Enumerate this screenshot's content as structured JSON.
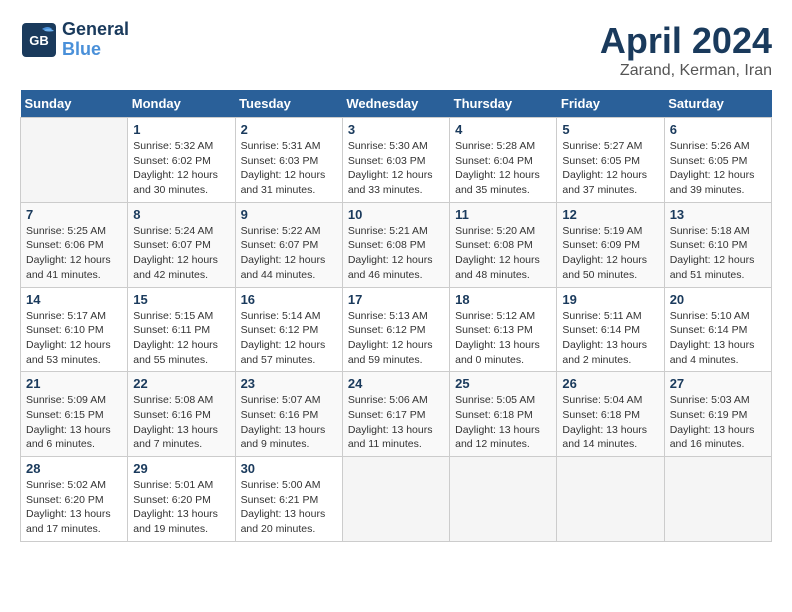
{
  "header": {
    "logo_line1": "General",
    "logo_line2": "Blue",
    "title": "April 2024",
    "subtitle": "Zarand, Kerman, Iran"
  },
  "calendar": {
    "days_of_week": [
      "Sunday",
      "Monday",
      "Tuesday",
      "Wednesday",
      "Thursday",
      "Friday",
      "Saturday"
    ],
    "weeks": [
      [
        {
          "num": "",
          "detail": ""
        },
        {
          "num": "1",
          "detail": "Sunrise: 5:32 AM\nSunset: 6:02 PM\nDaylight: 12 hours\nand 30 minutes."
        },
        {
          "num": "2",
          "detail": "Sunrise: 5:31 AM\nSunset: 6:03 PM\nDaylight: 12 hours\nand 31 minutes."
        },
        {
          "num": "3",
          "detail": "Sunrise: 5:30 AM\nSunset: 6:03 PM\nDaylight: 12 hours\nand 33 minutes."
        },
        {
          "num": "4",
          "detail": "Sunrise: 5:28 AM\nSunset: 6:04 PM\nDaylight: 12 hours\nand 35 minutes."
        },
        {
          "num": "5",
          "detail": "Sunrise: 5:27 AM\nSunset: 6:05 PM\nDaylight: 12 hours\nand 37 minutes."
        },
        {
          "num": "6",
          "detail": "Sunrise: 5:26 AM\nSunset: 6:05 PM\nDaylight: 12 hours\nand 39 minutes."
        }
      ],
      [
        {
          "num": "7",
          "detail": "Sunrise: 5:25 AM\nSunset: 6:06 PM\nDaylight: 12 hours\nand 41 minutes."
        },
        {
          "num": "8",
          "detail": "Sunrise: 5:24 AM\nSunset: 6:07 PM\nDaylight: 12 hours\nand 42 minutes."
        },
        {
          "num": "9",
          "detail": "Sunrise: 5:22 AM\nSunset: 6:07 PM\nDaylight: 12 hours\nand 44 minutes."
        },
        {
          "num": "10",
          "detail": "Sunrise: 5:21 AM\nSunset: 6:08 PM\nDaylight: 12 hours\nand 46 minutes."
        },
        {
          "num": "11",
          "detail": "Sunrise: 5:20 AM\nSunset: 6:08 PM\nDaylight: 12 hours\nand 48 minutes."
        },
        {
          "num": "12",
          "detail": "Sunrise: 5:19 AM\nSunset: 6:09 PM\nDaylight: 12 hours\nand 50 minutes."
        },
        {
          "num": "13",
          "detail": "Sunrise: 5:18 AM\nSunset: 6:10 PM\nDaylight: 12 hours\nand 51 minutes."
        }
      ],
      [
        {
          "num": "14",
          "detail": "Sunrise: 5:17 AM\nSunset: 6:10 PM\nDaylight: 12 hours\nand 53 minutes."
        },
        {
          "num": "15",
          "detail": "Sunrise: 5:15 AM\nSunset: 6:11 PM\nDaylight: 12 hours\nand 55 minutes."
        },
        {
          "num": "16",
          "detail": "Sunrise: 5:14 AM\nSunset: 6:12 PM\nDaylight: 12 hours\nand 57 minutes."
        },
        {
          "num": "17",
          "detail": "Sunrise: 5:13 AM\nSunset: 6:12 PM\nDaylight: 12 hours\nand 59 minutes."
        },
        {
          "num": "18",
          "detail": "Sunrise: 5:12 AM\nSunset: 6:13 PM\nDaylight: 13 hours\nand 0 minutes."
        },
        {
          "num": "19",
          "detail": "Sunrise: 5:11 AM\nSunset: 6:14 PM\nDaylight: 13 hours\nand 2 minutes."
        },
        {
          "num": "20",
          "detail": "Sunrise: 5:10 AM\nSunset: 6:14 PM\nDaylight: 13 hours\nand 4 minutes."
        }
      ],
      [
        {
          "num": "21",
          "detail": "Sunrise: 5:09 AM\nSunset: 6:15 PM\nDaylight: 13 hours\nand 6 minutes."
        },
        {
          "num": "22",
          "detail": "Sunrise: 5:08 AM\nSunset: 6:16 PM\nDaylight: 13 hours\nand 7 minutes."
        },
        {
          "num": "23",
          "detail": "Sunrise: 5:07 AM\nSunset: 6:16 PM\nDaylight: 13 hours\nand 9 minutes."
        },
        {
          "num": "24",
          "detail": "Sunrise: 5:06 AM\nSunset: 6:17 PM\nDaylight: 13 hours\nand 11 minutes."
        },
        {
          "num": "25",
          "detail": "Sunrise: 5:05 AM\nSunset: 6:18 PM\nDaylight: 13 hours\nand 12 minutes."
        },
        {
          "num": "26",
          "detail": "Sunrise: 5:04 AM\nSunset: 6:18 PM\nDaylight: 13 hours\nand 14 minutes."
        },
        {
          "num": "27",
          "detail": "Sunrise: 5:03 AM\nSunset: 6:19 PM\nDaylight: 13 hours\nand 16 minutes."
        }
      ],
      [
        {
          "num": "28",
          "detail": "Sunrise: 5:02 AM\nSunset: 6:20 PM\nDaylight: 13 hours\nand 17 minutes."
        },
        {
          "num": "29",
          "detail": "Sunrise: 5:01 AM\nSunset: 6:20 PM\nDaylight: 13 hours\nand 19 minutes."
        },
        {
          "num": "30",
          "detail": "Sunrise: 5:00 AM\nSunset: 6:21 PM\nDaylight: 13 hours\nand 20 minutes."
        },
        {
          "num": "",
          "detail": ""
        },
        {
          "num": "",
          "detail": ""
        },
        {
          "num": "",
          "detail": ""
        },
        {
          "num": "",
          "detail": ""
        }
      ]
    ]
  }
}
